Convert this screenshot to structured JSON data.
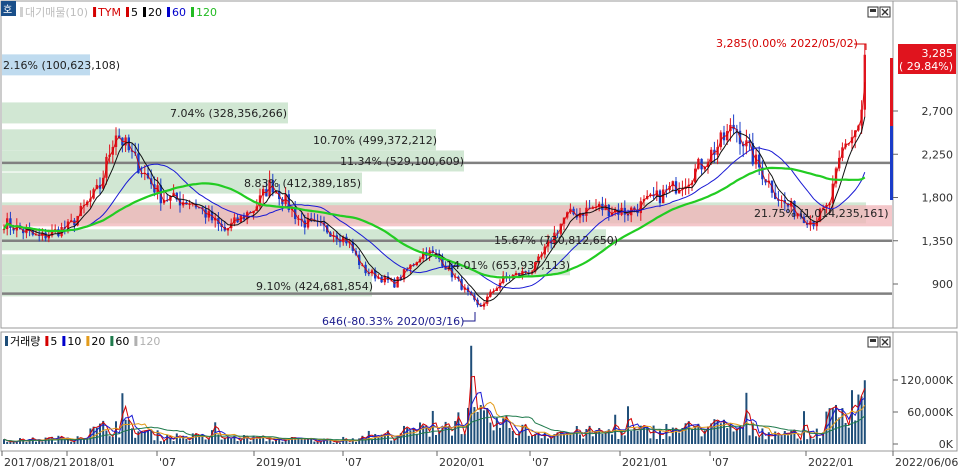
{
  "price_panel": {
    "legend": [
      {
        "label": "대기매물(10)",
        "color": "#bdbdbd",
        "marker": "#d0d0d0"
      },
      {
        "label": "TYM",
        "color": "#d40000",
        "marker": "#d40000"
      },
      {
        "label": "5",
        "color": "#000000",
        "marker": "#d40000"
      },
      {
        "label": "20",
        "color": "#000000",
        "marker": "#000000"
      },
      {
        "label": "60",
        "color": "#0000cc",
        "marker": "#0000cc"
      },
      {
        "label": "120",
        "color": "#22bb22",
        "marker": "#22bb22"
      }
    ],
    "last_price": "3,285",
    "last_change": "( 29.84%)",
    "high_annotation": "3,285(0.00% 2022/05/02)",
    "low_annotation": "646(-80.33% 2020/03/16)",
    "corner_badge": "호"
  },
  "volume_panel": {
    "legend": [
      {
        "label": "거래량",
        "color": "#000000",
        "marker": "#1f4e79"
      },
      {
        "label": "5",
        "color": "#000000",
        "marker": "#d40000"
      },
      {
        "label": "10",
        "color": "#000000",
        "marker": "#0000cc"
      },
      {
        "label": "20",
        "color": "#000000",
        "marker": "#e39b1a"
      },
      {
        "label": "60",
        "color": "#000000",
        "marker": "#1f7a4c"
      },
      {
        "label": "120",
        "color": "#000000",
        "marker": "#b0b0b0"
      }
    ]
  },
  "x_labels": [
    "2017/08/21",
    "2018/01",
    "'07",
    "2019/01",
    "'07",
    "2020/01",
    "'07",
    "2021/01",
    "'07",
    "2022/01",
    "2022/06/06"
  ],
  "chart_data": [
    {
      "type": "candlestick",
      "title": "TYM",
      "y_ticks": [
        900,
        1350,
        1800,
        2250,
        2700
      ],
      "ylim": [
        646,
        3285
      ],
      "horizontal_levels": [
        2160,
        1350,
        800
      ],
      "resistance_band": [
        1500,
        1720
      ],
      "volume_profile": [
        {
          "label": "2.16% (100,623,108)",
          "price": 3180
        },
        {
          "label": "7.04% (328,356,266)",
          "price": 2680
        },
        {
          "label": "10.70% (499,372,212)",
          "price": 2400
        },
        {
          "label": "11.34% (529,100,609)",
          "price": 2180
        },
        {
          "label": "8.83% (412,389,185)",
          "price": 1950
        },
        {
          "label": "21.75% (1,014,235,161)",
          "price": 1640
        },
        {
          "label": "15.67% (730,812,650)",
          "price": 1360
        },
        {
          "label": "14.01% (653,937,113)",
          "price": 1100
        },
        {
          "label": "9.10% (424,681,854)",
          "price": 880
        }
      ],
      "price_path": [
        [
          "2017/08/21",
          1550
        ],
        [
          "2017/11",
          1380
        ],
        [
          "2018/01",
          1500
        ],
        [
          "2018/03",
          1900
        ],
        [
          "2018/04",
          2500
        ],
        [
          "2018/05",
          2250
        ],
        [
          "2018/07",
          1800
        ],
        [
          "2018/09",
          1750
        ],
        [
          "2018/11",
          1450
        ],
        [
          "2019/01",
          1700
        ],
        [
          "2019/02",
          1950
        ],
        [
          "2019/04",
          1550
        ],
        [
          "2019/06",
          1450
        ],
        [
          "2019/07",
          1350
        ],
        [
          "2019/08",
          1050
        ],
        [
          "2019/10",
          900
        ],
        [
          "2019/12",
          1250
        ],
        [
          "2020/01",
          1150
        ],
        [
          "2020/03/16",
          646
        ],
        [
          "2020/05",
          950
        ],
        [
          "2020/07",
          1050
        ],
        [
          "2020/09",
          1600
        ],
        [
          "2020/11",
          1700
        ],
        [
          "2021/01",
          1650
        ],
        [
          "2021/03",
          1800
        ],
        [
          "2021/05",
          2000
        ],
        [
          "2021/07",
          2350
        ],
        [
          "2021/08",
          2550
        ],
        [
          "2021/09",
          2250
        ],
        [
          "2021/11",
          1750
        ],
        [
          "2022/01",
          1550
        ],
        [
          "2022/02",
          1700
        ],
        [
          "2022/03",
          2300
        ],
        [
          "2022/04",
          2550
        ],
        [
          "2022/05/02",
          3285
        ]
      ]
    },
    {
      "type": "bar",
      "title": "거래량",
      "y_ticks": [
        "0K",
        "60,000K",
        "120,000K"
      ],
      "ylim": [
        0,
        180000
      ],
      "volume_path": [
        [
          "2017/08/21",
          8000
        ],
        [
          "2018/01",
          15000
        ],
        [
          "2018/04",
          50000
        ],
        [
          "2018/07",
          20000
        ],
        [
          "2019/01",
          15000
        ],
        [
          "2019/07",
          8000
        ],
        [
          "2020/01",
          45000
        ],
        [
          "2020/03",
          70000
        ],
        [
          "2020/07",
          30000
        ],
        [
          "2021/01",
          30000
        ],
        [
          "2021/07",
          45000
        ],
        [
          "2022/01",
          20000
        ],
        [
          "2022/04",
          140000
        ],
        [
          "2022/05/02",
          100000
        ]
      ]
    }
  ]
}
